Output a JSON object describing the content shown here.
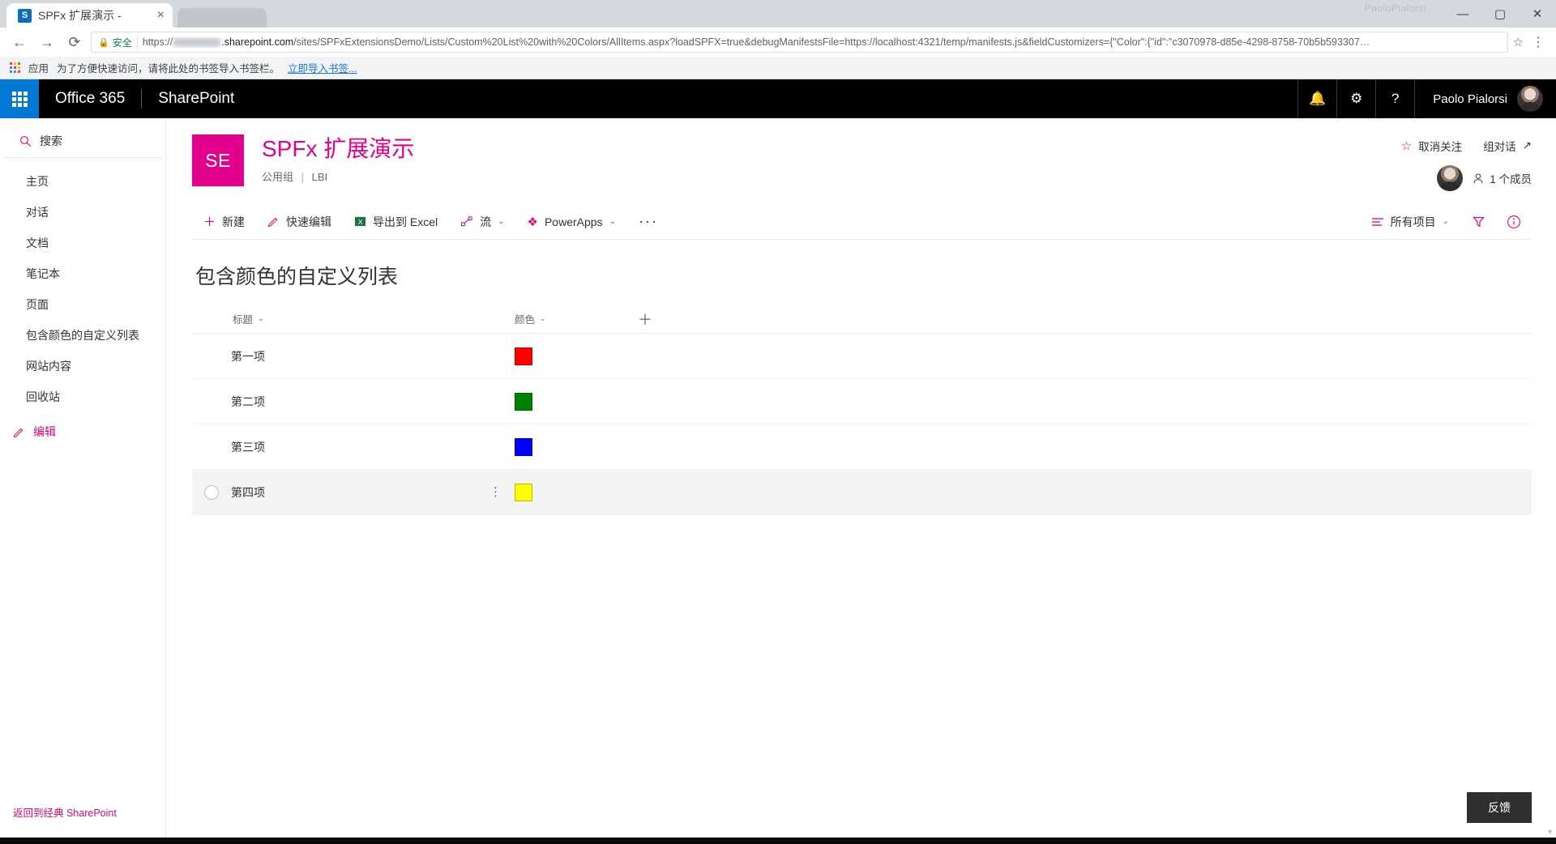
{
  "browser": {
    "tab": {
      "title": "SPFx 扩展演示 -",
      "favicon_text": "S",
      "close_icon": "×"
    },
    "window_watermark": "PaoloPialorsi",
    "window_controls": {
      "minimize": "—",
      "maximize": "▢",
      "close": "✕"
    },
    "nav": {
      "back": "←",
      "forward": "→",
      "reload": "⟳"
    },
    "omnibox": {
      "lock_icon": "🔒",
      "secure_label": "安全",
      "url_prefix": "https://",
      "url_host_suffix": ".sharepoint.com",
      "url_path": "/sites/SPFxExtensionsDemo/Lists/Custom%20List%20with%20Colors/AllItems.aspx?loadSPFX=true&debugManifestsFile=https://localhost:4321/temp/manifests.js&fieldCustomizers={\"Color\":{\"id\":\"c3070978-d85e-4298-8758-70b5b593307…",
      "star_icon": "☆",
      "menu_icon": "⋮"
    },
    "bookmarks": {
      "apps_label": "应用",
      "notice": "为了方便快速访问，请将此处的书签导入书签栏。",
      "import_link": "立即导入书签..."
    }
  },
  "suitebar": {
    "waffle_icon": "app-launcher-icon",
    "brand": "Office 365",
    "app_name": "SharePoint",
    "icons": {
      "notification": "🔔",
      "settings": "⚙",
      "help": "?"
    },
    "user_name": "Paolo Pialorsi"
  },
  "leftnav": {
    "search_icon": "search-icon",
    "search_label": "搜索",
    "items": [
      {
        "label": "主页"
      },
      {
        "label": "对话"
      },
      {
        "label": "文档"
      },
      {
        "label": "笔记本"
      },
      {
        "label": "页面"
      },
      {
        "label": "包含颜色的自定义列表"
      },
      {
        "label": "网站内容"
      },
      {
        "label": "回收站"
      }
    ],
    "edit_label": "编辑",
    "classic_link": "返回到经典 SharePoint"
  },
  "site": {
    "logo_initials": "SE",
    "title": "SPFx 扩展演示",
    "group_type": "公用组",
    "divider": "|",
    "classification": "LBI",
    "follow_label": "取消关注",
    "conversation_label": "组对话",
    "conversation_icon": "↗",
    "members_label": "1 个成员",
    "accent_color": "#e3008c"
  },
  "commandbar": {
    "items": [
      {
        "label": "新建",
        "icon": "plus-icon",
        "glyph": "＋",
        "has_chevron": false
      },
      {
        "label": "快速编辑",
        "icon": "pencil-icon",
        "glyph": "✎",
        "has_chevron": false
      },
      {
        "label": "导出到 Excel",
        "icon": "excel-icon",
        "glyph": "X",
        "has_chevron": false
      },
      {
        "label": "流",
        "icon": "flow-icon",
        "glyph": "⇱",
        "has_chevron": true
      },
      {
        "label": "PowerApps",
        "icon": "powerapps-icon",
        "glyph": "❖",
        "has_chevron": true
      }
    ],
    "overflow": "···",
    "view_label": "所有项目",
    "view_icon": "list-view-icon",
    "filter_icon": "filter-icon",
    "info_icon": "info-icon",
    "chevron": "⌄"
  },
  "list": {
    "title": "包含颜色的自定义列表",
    "columns": [
      {
        "key": "title",
        "label": "标题"
      },
      {
        "key": "color",
        "label": "颜色"
      }
    ],
    "add_column_icon": "＋",
    "rows": [
      {
        "title": "第一项",
        "color": "#ff0000",
        "hovered": false
      },
      {
        "title": "第二项",
        "color": "#008000",
        "hovered": false
      },
      {
        "title": "第三项",
        "color": "#0000ff",
        "hovered": false
      },
      {
        "title": "第四项",
        "color": "#ffff00",
        "hovered": true
      }
    ],
    "row_menu_icon": "⋮"
  },
  "feedback": {
    "label": "反馈"
  }
}
